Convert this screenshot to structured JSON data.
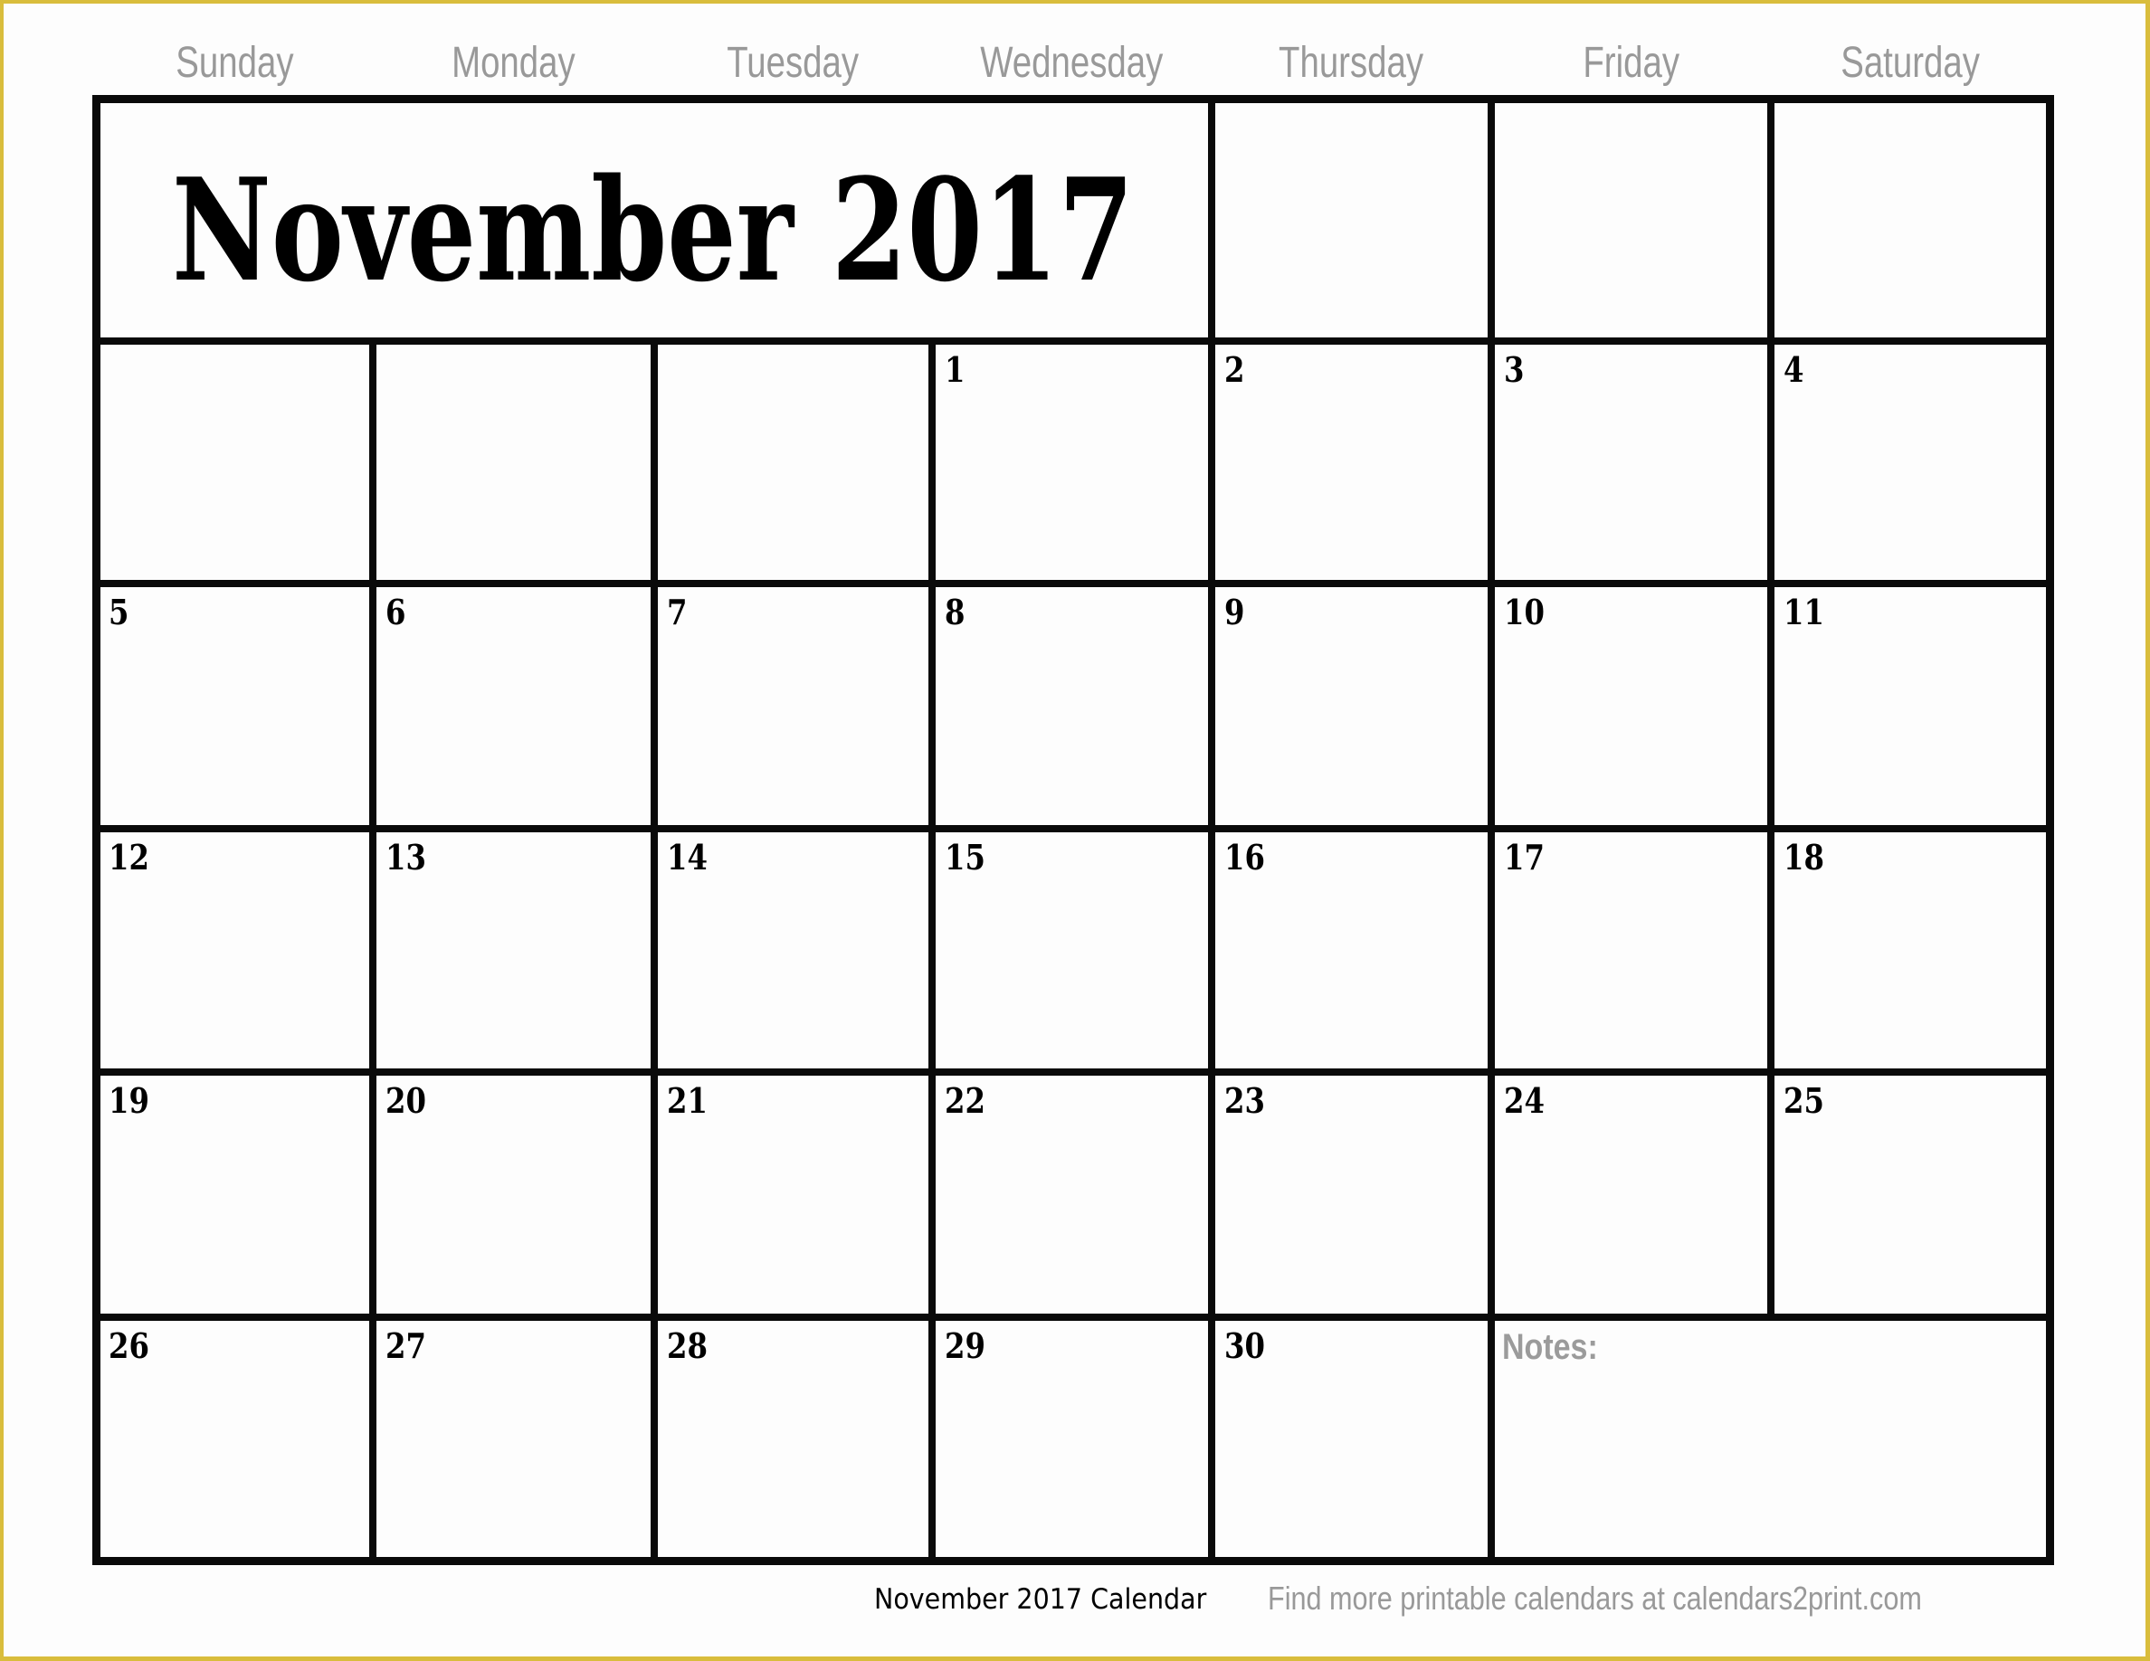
{
  "calendar": {
    "title": "November 2017",
    "month": "November",
    "year": 2017,
    "weekdays": [
      "Sunday",
      "Monday",
      "Tuesday",
      "Wednesday",
      "Thursday",
      "Friday",
      "Saturday"
    ],
    "first_weekday_index": 3,
    "days_in_month": 30,
    "weeks": [
      [
        "",
        "",
        "",
        "1",
        "2",
        "3",
        "4"
      ],
      [
        "5",
        "6",
        "7",
        "8",
        "9",
        "10",
        "11"
      ],
      [
        "12",
        "13",
        "14",
        "15",
        "16",
        "17",
        "18"
      ],
      [
        "19",
        "20",
        "21",
        "22",
        "23",
        "24",
        "25"
      ],
      [
        "26",
        "27",
        "28",
        "29",
        "30",
        "",
        ""
      ]
    ],
    "notes_label": "Notes:"
  },
  "footer": {
    "caption": "November 2017 Calendar",
    "promo": "Find more printable calendars at calendars2print.com"
  },
  "colors": {
    "frame": "#d9bd3c",
    "grid": "#0a0a0a",
    "muted_text": "#999999"
  }
}
